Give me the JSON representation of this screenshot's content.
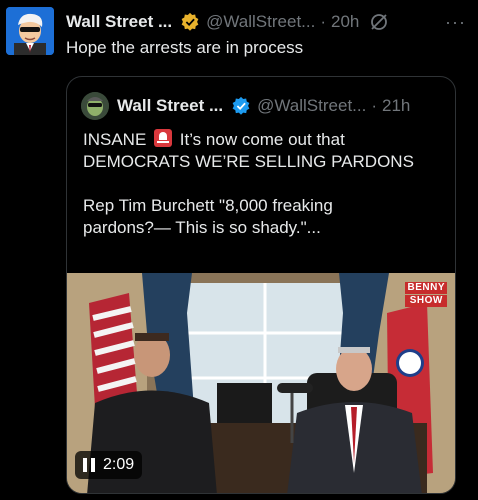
{
  "tweet": {
    "author_name": "Wall Street ...",
    "handle": "@WallStreet...",
    "separator": "·",
    "time": "20h",
    "text": "Hope the arrests are in process",
    "more": "···"
  },
  "quoted_tweet": {
    "author_name": "Wall Street ...",
    "handle": "@WallStreet...",
    "separator": "·",
    "time": "21h",
    "line1_a": "INSANE",
    "line1_b": "It’s now come out that",
    "line2": "DEMOCRATS WE’RE SELLING PARDONS",
    "line3": "Rep Tim Burchett \"8,000 freaking",
    "line4": "pardons?— This is so shady.\"..."
  },
  "video": {
    "duration": "2:09",
    "brand_top": "BENNY",
    "brand_bottom": "SHOW"
  },
  "colors": {
    "verified_badge_gold": "#e8b22c",
    "verified_badge_blue": "#1d9bf0",
    "muted_text": "#71767b",
    "border": "#2f3336"
  }
}
